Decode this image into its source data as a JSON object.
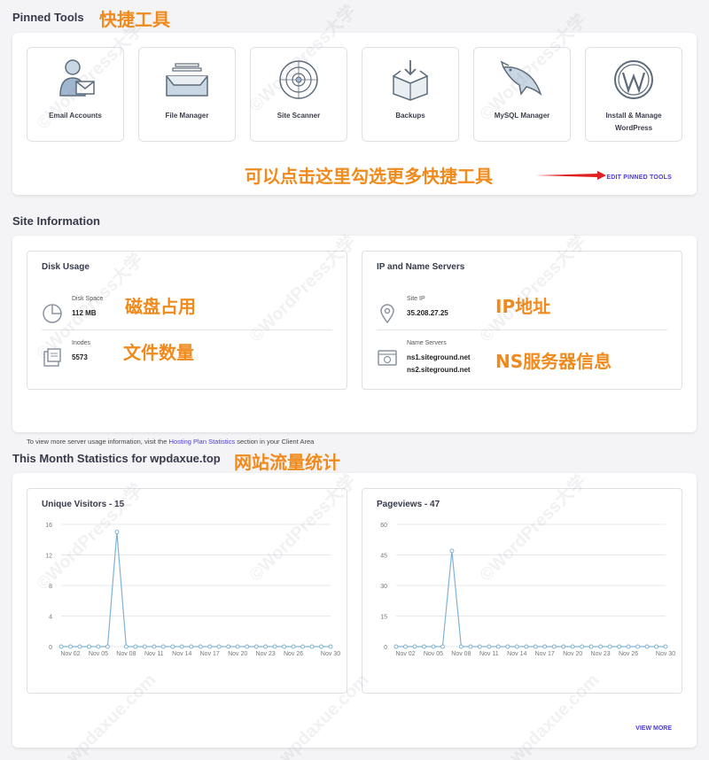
{
  "pinned": {
    "title": "Pinned Tools",
    "annotation": "快捷工具",
    "tools": [
      {
        "label": "Email Accounts",
        "icon": "email-accounts-icon"
      },
      {
        "label": "File Manager",
        "icon": "file-manager-icon"
      },
      {
        "label": "Site Scanner",
        "icon": "site-scanner-icon"
      },
      {
        "label": "Backups",
        "icon": "backups-icon"
      },
      {
        "label": "MySQL Manager",
        "icon": "mysql-manager-icon"
      },
      {
        "label": "Install & Manage WordPress",
        "icon": "wordpress-icon"
      }
    ],
    "edit_annotation": "可以点击这里勾选更多快捷工具",
    "edit_label": "EDIT PINNED TOOLS"
  },
  "site_info": {
    "title": "Site Information",
    "disk": {
      "title": "Disk Usage",
      "space_label": "Disk Space",
      "space_value": "112 MB",
      "space_annotation": "磁盘占用",
      "inodes_label": "Inodes",
      "inodes_value": "5573",
      "inodes_annotation": "文件数量"
    },
    "ip": {
      "title": "IP and Name Servers",
      "ip_label": "Site IP",
      "ip_value": "35.208.27.25",
      "ip_annotation": "IP地址",
      "ns_label": "Name Servers",
      "ns1": "ns1.siteground.net",
      "ns2": "ns2.siteground.net",
      "ns_annotation": "NS服务器信息"
    },
    "footnote_pre": "To view more server usage information, visit the ",
    "footnote_link": "Hosting Plan Statistics",
    "footnote_post": " section in your Client Area"
  },
  "stats": {
    "title": "This Month Statistics for wpdaxue.top",
    "annotation": "网站流量统计",
    "view_more": "VIEW MORE"
  },
  "watermark": {
    "brand": "©WordPress大学",
    "domain": "wpdaxue.com"
  },
  "colors": {
    "accent": "#4b3bd9",
    "annotation": "#f08a1c",
    "chart_line": "#7fb3d5",
    "arrow": "#e02020"
  },
  "chart_data": [
    {
      "type": "line",
      "title": "Unique Visitors - 15",
      "x": [
        "Nov 01",
        "Nov 02",
        "Nov 03",
        "Nov 04",
        "Nov 05",
        "Nov 06",
        "Nov 07",
        "Nov 08",
        "Nov 09",
        "Nov 10",
        "Nov 11",
        "Nov 12",
        "Nov 13",
        "Nov 14",
        "Nov 15",
        "Nov 16",
        "Nov 17",
        "Nov 18",
        "Nov 19",
        "Nov 20",
        "Nov 21",
        "Nov 22",
        "Nov 23",
        "Nov 24",
        "Nov 25",
        "Nov 26",
        "Nov 27",
        "Nov 28",
        "Nov 29",
        "Nov 30"
      ],
      "values": [
        0,
        0,
        0,
        0,
        0,
        0,
        15,
        0,
        0,
        0,
        0,
        0,
        0,
        0,
        0,
        0,
        0,
        0,
        0,
        0,
        0,
        0,
        0,
        0,
        0,
        0,
        0,
        0,
        0,
        0
      ],
      "x_ticks": [
        "Nov 02",
        "Nov 05",
        "Nov 08",
        "Nov 11",
        "Nov 14",
        "Nov 17",
        "Nov 20",
        "Nov 23",
        "Nov 26",
        "Nov 30"
      ],
      "y_ticks": [
        0,
        4,
        8,
        12,
        16
      ],
      "ylim": [
        0,
        16
      ],
      "grid": true
    },
    {
      "type": "line",
      "title": "Pageviews - 47",
      "x": [
        "Nov 01",
        "Nov 02",
        "Nov 03",
        "Nov 04",
        "Nov 05",
        "Nov 06",
        "Nov 07",
        "Nov 08",
        "Nov 09",
        "Nov 10",
        "Nov 11",
        "Nov 12",
        "Nov 13",
        "Nov 14",
        "Nov 15",
        "Nov 16",
        "Nov 17",
        "Nov 18",
        "Nov 19",
        "Nov 20",
        "Nov 21",
        "Nov 22",
        "Nov 23",
        "Nov 24",
        "Nov 25",
        "Nov 26",
        "Nov 27",
        "Nov 28",
        "Nov 29",
        "Nov 30"
      ],
      "values": [
        0,
        0,
        0,
        0,
        0,
        0,
        47,
        0,
        0,
        0,
        0,
        0,
        0,
        0,
        0,
        0,
        0,
        0,
        0,
        0,
        0,
        0,
        0,
        0,
        0,
        0,
        0,
        0,
        0,
        0
      ],
      "x_ticks": [
        "Nov 02",
        "Nov 05",
        "Nov 08",
        "Nov 11",
        "Nov 14",
        "Nov 17",
        "Nov 20",
        "Nov 23",
        "Nov 26",
        "Nov 30"
      ],
      "y_ticks": [
        0,
        15,
        30,
        45,
        60
      ],
      "ylim": [
        0,
        60
      ],
      "grid": true
    }
  ]
}
